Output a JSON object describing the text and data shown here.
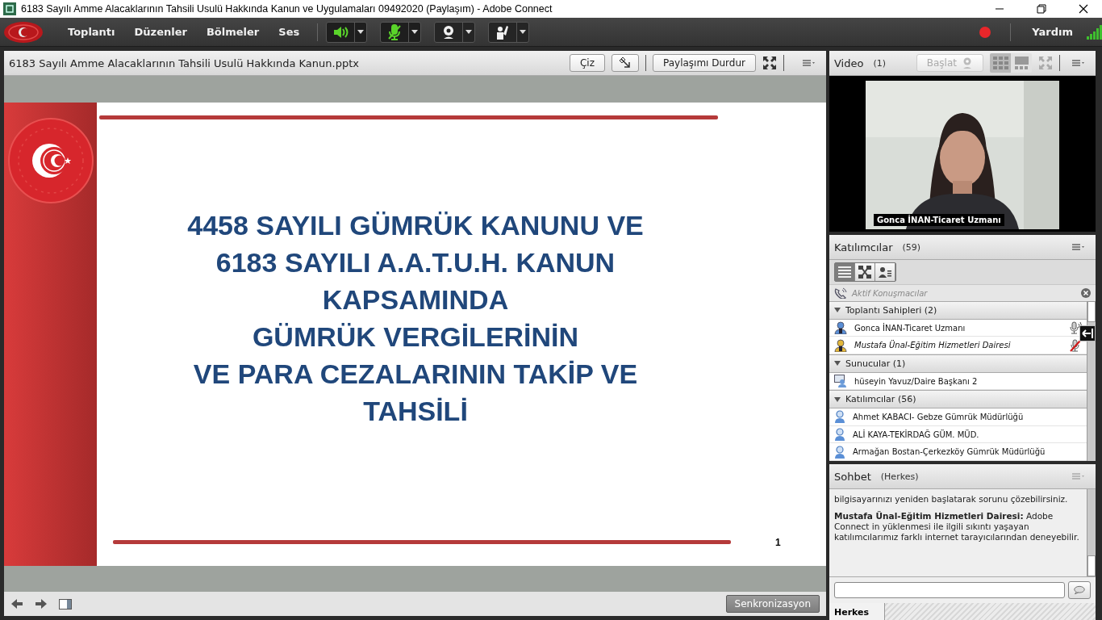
{
  "window": {
    "title": "6183 Sayılı Amme Alacaklarının Tahsili Usulü Hakkında Kanun ve Uygulamaları 09492020 (Paylaşım) - Adobe Connect"
  },
  "menu_bar": {
    "items": [
      "Toplantı",
      "Düzenler",
      "Bölmeler",
      "Ses"
    ],
    "tools": [
      {
        "kind": "speaker",
        "on": true
      },
      {
        "kind": "microphone",
        "on": true
      },
      {
        "kind": "camera",
        "on": false
      },
      {
        "kind": "hand",
        "on": false
      }
    ],
    "recording": true,
    "help": "Yardım"
  },
  "share_pod": {
    "title": "6183 Sayılı Amme Alacaklarının Tahsili Usulü Hakkında Kanun.pptx",
    "draw_button": "Çiz",
    "stop_button": "Paylaşımı Durdur",
    "slide": {
      "heading": [
        "4458 SAYILI GÜMRÜK KANUNU VE",
        "6183 SAYILI A.A.T.U.H. KANUN",
        "KAPSAMINDA",
        "GÜMRÜK VERGİLERİNİN",
        "VE PARA CEZALARININ TAKİP VE",
        "TAHSİLİ"
      ],
      "page": "1"
    },
    "sync_button": "Senkronizasyon"
  },
  "video_pod": {
    "title": "Video",
    "count": "(1)",
    "start_button": {
      "label": "Başlat",
      "disabled": true
    },
    "layouts": [
      {
        "kind": "grid",
        "selected": true
      },
      {
        "kind": "filmstrip",
        "selected": false
      }
    ],
    "stream": {
      "kind": "picture",
      "caption": "Gonca İNAN-Ticaret Uzmanı"
    }
  },
  "attendee_pod": {
    "title": "Katılımcılar",
    "count": "(59)",
    "views": [
      {
        "kind": "list",
        "selected": true
      },
      {
        "kind": "breakout",
        "selected": false
      },
      {
        "kind": "status",
        "selected": false
      }
    ],
    "active_speakers": "Aktif Konuşmacılar",
    "groups": [
      {
        "name": "Toplantı Sahipleri (2)",
        "expanded": true,
        "members": [
          {
            "name": "Gonca İNAN-Ticaret Uzmanı",
            "kind": "host",
            "self": false,
            "mic": {
              "kind": "speaking"
            }
          },
          {
            "name": "Mustafa Ünal-Eğitim Hizmetleri Dairesi",
            "kind": "host",
            "self": true,
            "mic": {
              "kind": "muted"
            }
          }
        ]
      },
      {
        "name": "Sunucular (1)",
        "expanded": true,
        "members": [
          {
            "name": "hüseyin Yavuz/Daire Başkanı 2",
            "kind": "presenter",
            "self": false
          }
        ]
      },
      {
        "name": "Katılımcılar (56)",
        "expanded": true,
        "members": [
          {
            "name": "Ahmet KABACI- Gebze Gümrük Müdürlüğü",
            "kind": "participant",
            "self": false
          },
          {
            "name": "ALİ KAYA-TEKİRDAĞ GÜM. MÜD.",
            "kind": "participant",
            "self": false
          },
          {
            "name": "Armağan Bostan-Çerkezköy Gümrük Müdürlüğü",
            "kind": "participant",
            "self": false
          }
        ]
      }
    ]
  },
  "chat_pod": {
    "title": "Sohbet",
    "scope": "(Herkes)",
    "messages": [
      "bilgisayarınızı yeniden başlatarak sorunu çözebilirsiniz.",
      "**Mustafa Ünal-Eğitim Hizmetleri Dairesi:** Adobe Connect in yüklenmesi ile ilgili sıkıntı yaşayan katılımcılarımız farklı internet tarayıcılarından deneyebilir."
    ],
    "tabs": [
      {
        "label": "Herkes",
        "selected": true
      }
    ]
  }
}
